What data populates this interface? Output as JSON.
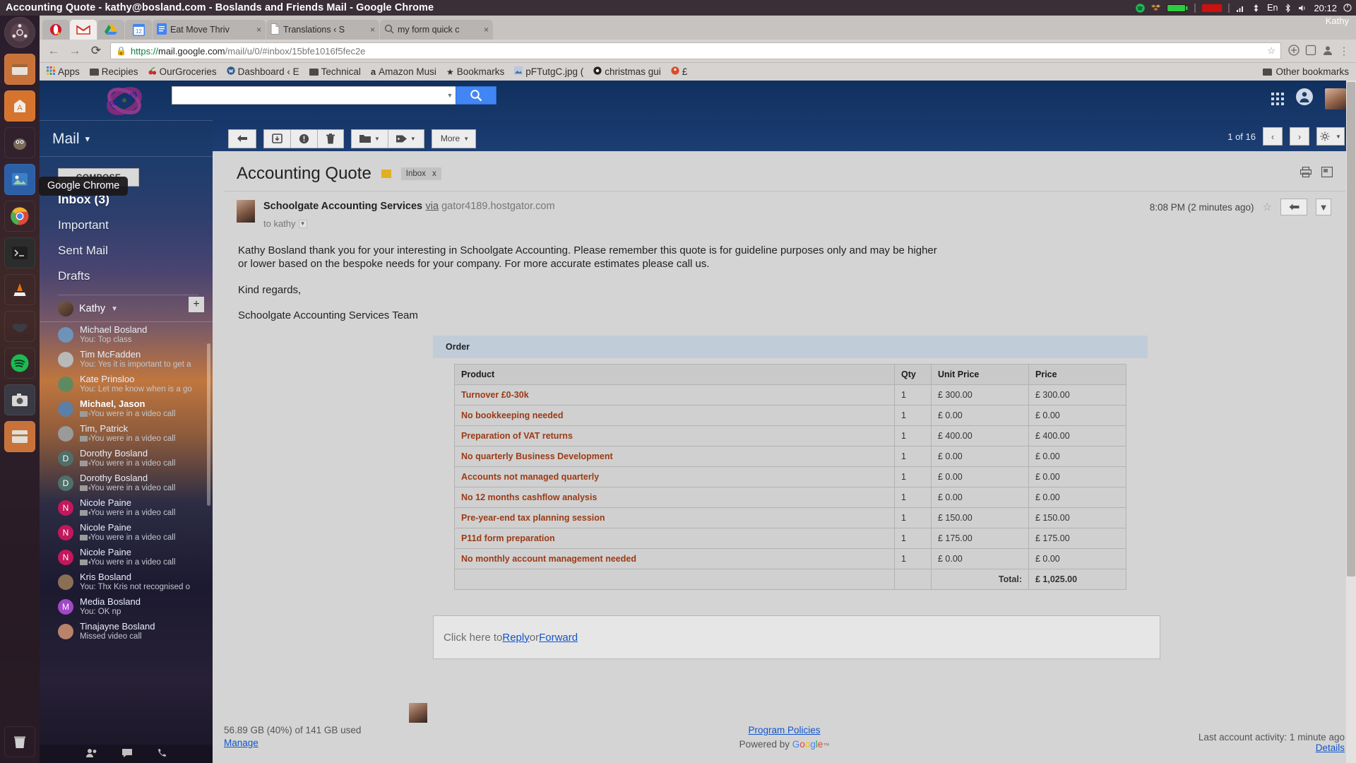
{
  "window": {
    "title": "Accounting Quote - kathy@bosland.com - Boslands and Friends Mail - Google Chrome"
  },
  "system_tray": {
    "clock": "20:12",
    "user": "Kathy",
    "keyboard": "En",
    "icons": [
      "spotify-icon",
      "dropbox-icon",
      "battery-icon",
      "recording-icon",
      "network-icon",
      "bluetooth-icon",
      "volume-icon"
    ]
  },
  "browser": {
    "tabs": [
      {
        "label": "",
        "favicon": "opera-icon",
        "active": false
      },
      {
        "label": "",
        "favicon": "gmail-icon",
        "active": true
      },
      {
        "label": "",
        "favicon": "drive-icon",
        "active": false
      },
      {
        "label": "",
        "favicon": "calendar-icon",
        "active": false
      },
      {
        "label": "Eat Move Thriv",
        "favicon": "docs-icon",
        "close": "×",
        "active": false
      },
      {
        "label": "Translations ‹ S",
        "favicon": "page-icon",
        "close": "×",
        "active": false
      },
      {
        "label": "my form quick c",
        "favicon": "search-icon",
        "close": "×",
        "active": false
      }
    ],
    "url": {
      "scheme": "https://",
      "host": "mail.google.com",
      "path": "/mail/u/0/#inbox/15bfe1016f5fec2e",
      "lock": "lock-icon"
    },
    "nav": {
      "back": "←",
      "forward": "→",
      "reload": "⟳"
    },
    "bookmarks": [
      {
        "label": "Apps",
        "icon": "apps-grid-icon"
      },
      {
        "label": "Recipies",
        "icon": "folder-icon"
      },
      {
        "label": "OurGroceries",
        "icon": "cherry-icon"
      },
      {
        "label": "Dashboard ‹ E",
        "icon": "wordpress-icon"
      },
      {
        "label": "Technical",
        "icon": "folder-icon"
      },
      {
        "label": "Amazon Musi",
        "icon": "amazon-icon"
      },
      {
        "label": "Bookmarks",
        "icon": "star-icon"
      },
      {
        "label": "pFTutgC.jpg (",
        "icon": "image-icon"
      },
      {
        "label": "christmas gui",
        "icon": "chrome-icon"
      },
      {
        "label": "£",
        "icon": "site-icon"
      }
    ],
    "other_bookmarks": "Other bookmarks"
  },
  "desktop": {
    "tooltip": "Google Chrome"
  },
  "gmail": {
    "search_placeholder": "",
    "search_value": "",
    "search_button": "search-icon",
    "mail_dropdown": "Mail",
    "compose": "COMPOSE",
    "labels": [
      {
        "name": "Inbox (3)",
        "bold": true
      },
      {
        "name": "Important",
        "bold": false
      },
      {
        "name": "Sent Mail",
        "bold": false
      },
      {
        "name": "Drafts",
        "bold": false
      }
    ],
    "chat": {
      "owner": "Kathy",
      "add_button": "+",
      "contacts": [
        {
          "name": "Michael Bosland",
          "snippet": "You: Top class",
          "video": false,
          "bold": false,
          "avatar_color": "#6f93b8",
          "initial": ""
        },
        {
          "name": "Tim McFadden",
          "snippet": "You: Yes it is important to get a",
          "video": false,
          "bold": false,
          "avatar_color": "#b9b9b9",
          "initial": ""
        },
        {
          "name": "Kate Prinsloo",
          "snippet": "You: Let me know when is a go",
          "video": false,
          "bold": false,
          "avatar_color": "#5f8a5f",
          "initial": ""
        },
        {
          "name": "Michael, Jason",
          "snippet": "You were in a video call",
          "video": true,
          "bold": true,
          "avatar_color": "#5b7fa5",
          "initial": ""
        },
        {
          "name": "Tim, Patrick",
          "snippet": "You were in a video call",
          "video": true,
          "bold": false,
          "avatar_color": "#9a9a9a",
          "initial": ""
        },
        {
          "name": "Dorothy Bosland",
          "snippet": "You were in a video call",
          "video": true,
          "bold": false,
          "avatar_color": "#4f6f6b",
          "initial": "D"
        },
        {
          "name": "Dorothy Bosland",
          "snippet": "You were in a video call",
          "video": true,
          "bold": false,
          "avatar_color": "#4f6f6b",
          "initial": "D"
        },
        {
          "name": "Nicole Paine",
          "snippet": "You were in a video call",
          "video": true,
          "bold": false,
          "avatar_color": "#c2185b",
          "initial": "N"
        },
        {
          "name": "Nicole Paine",
          "snippet": "You were in a video call",
          "video": true,
          "bold": false,
          "avatar_color": "#c2185b",
          "initial": "N"
        },
        {
          "name": "Nicole Paine",
          "snippet": "You were in a video call",
          "video": true,
          "bold": false,
          "avatar_color": "#c2185b",
          "initial": "N"
        },
        {
          "name": "Kris Bosland",
          "snippet": "You: Thx Kris not recognised o",
          "video": false,
          "bold": false,
          "avatar_color": "#8a6f55",
          "initial": ""
        },
        {
          "name": "Media Bosland",
          "snippet": "You: OK np",
          "video": false,
          "bold": false,
          "avatar_color": "#a347c9",
          "initial": "M"
        },
        {
          "name": "Tinajayne Bosland",
          "snippet": "Missed video call",
          "video": false,
          "bold": false,
          "avatar_color": "#b8836a",
          "initial": ""
        }
      ]
    },
    "toolbar": {
      "back": "back-arrow-icon",
      "archive": "archive-icon",
      "spam": "spam-icon",
      "delete": "trash-icon",
      "move_to": "folder-icon",
      "labels": "label-icon",
      "more": "More"
    },
    "pager": {
      "count": "1 of 16",
      "prev": "‹",
      "next": "›",
      "settings": "gear-icon"
    },
    "email": {
      "subject": "Accounting Quote",
      "label_chip": "Inbox",
      "label_chip_close": "x",
      "sender": "Schoolgate Accounting Services",
      "via": "via",
      "via_domain": "gator4189.hostgator.com",
      "to": "to kathy",
      "time": "8:08 PM (2 minutes ago)",
      "body": [
        "Kathy Bosland thank you for your interesting in Schoolgate Accounting. Please remember this quote is for guideline purposes only and may be higher or lower based on the bespoke needs for your company. For more accurate estimates please call us.",
        "Kind regards,",
        "Schoolgate Accounting Services Team"
      ],
      "reply_prompt": "Click here to ",
      "reply_link": "Reply",
      "reply_or": " or ",
      "forward_link": "Forward"
    },
    "order": {
      "title": "Order",
      "columns": [
        "Product",
        "Qty",
        "Unit Price",
        "Price"
      ],
      "rows": [
        {
          "product": "Turnover £0-30k",
          "qty": "1",
          "unit": "£ 300.00",
          "price": "£ 300.00"
        },
        {
          "product": "No bookkeeping needed",
          "qty": "1",
          "unit": "£ 0.00",
          "price": "£ 0.00"
        },
        {
          "product": "Preparation of VAT returns",
          "qty": "1",
          "unit": "£ 400.00",
          "price": "£ 400.00"
        },
        {
          "product": "No quarterly Business Development",
          "qty": "1",
          "unit": "£ 0.00",
          "price": "£ 0.00"
        },
        {
          "product": "Accounts not managed quarterly",
          "qty": "1",
          "unit": "£ 0.00",
          "price": "£ 0.00"
        },
        {
          "product": "No 12 months cashflow analysis",
          "qty": "1",
          "unit": "£ 0.00",
          "price": "£ 0.00"
        },
        {
          "product": "Pre-year-end tax planning session",
          "qty": "1",
          "unit": "£ 150.00",
          "price": "£ 150.00"
        },
        {
          "product": "P11d form preparation",
          "qty": "1",
          "unit": "£ 175.00",
          "price": "£ 175.00"
        },
        {
          "product": "No monthly account management needed",
          "qty": "1",
          "unit": "£ 0.00",
          "price": "£ 0.00"
        }
      ],
      "total_label": "Total:",
      "total_value": "£ 1,025.00"
    },
    "footer": {
      "storage": "56.89 GB (40%) of 141 GB used",
      "manage": "Manage",
      "policies": "Program Policies",
      "powered": "Powered by",
      "google": "Google",
      "activity": "Last account activity: 1 minute ago",
      "details": "Details"
    }
  },
  "colors": {
    "gmail_blue": "#16366a",
    "accent_red": "#9c3a14",
    "link_blue": "#1155cc",
    "search_blue": "#4285f4"
  }
}
